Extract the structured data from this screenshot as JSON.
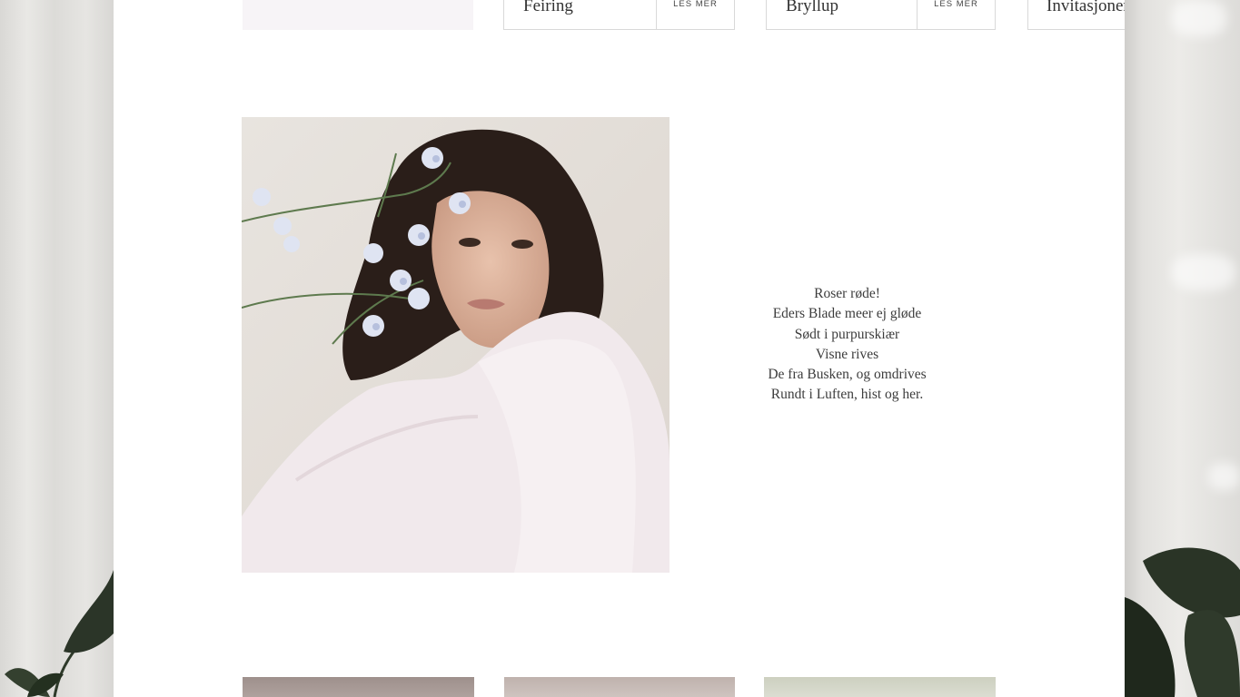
{
  "cards": [
    {
      "title": "Feiring",
      "button": "LES MER"
    },
    {
      "title": "Bryllup",
      "button": "LES MER"
    },
    {
      "title": "Invitasjoner"
    }
  ],
  "poem": [
    "Roser røde!",
    "Eders Blade meer ej gløde",
    "Sødt i purpurskiær",
    "Visne rives",
    "De fra Busken, og omdrives",
    "Rundt i Luften, hist og her."
  ],
  "colors": {
    "page_background": "#ffffff",
    "text": "#3c3c3c",
    "card_border": "#d9d9d9",
    "pink_thumbnail": "#f7f4f7"
  }
}
